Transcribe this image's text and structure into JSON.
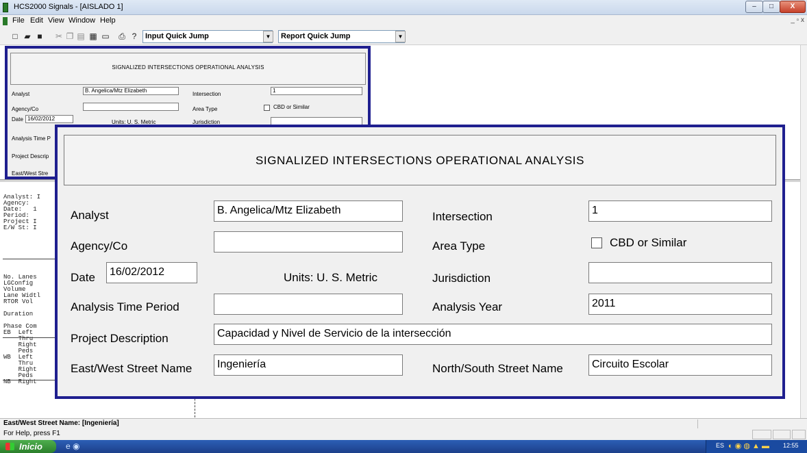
{
  "window": {
    "title": "HCS2000 Signals - [AISLADO 1]",
    "minimize": "–",
    "maximize": "□",
    "close": "X",
    "mdi_controls": "_ ▫ x"
  },
  "menu": [
    "File",
    "Edit",
    "View",
    "Window",
    "Help"
  ],
  "toolbar": {
    "input_quick_jump": "Input Quick Jump",
    "report_quick_jump": "Report Quick Jump",
    "dropdown_arrow": "▼"
  },
  "small_dialog": {
    "title": "SIGNALIZED INTERSECTIONS OPERATIONAL ANALYSIS",
    "analyst_label": "Analyst",
    "analyst_value": "B. Angelica/Mtz Elizabeth",
    "intersection_label": "Intersection",
    "intersection_value": "1",
    "agency_label": "Agency/Co",
    "area_type_label": "Area Type",
    "cbd_label": "CBD or Similar",
    "date_label": "Date",
    "date_value": "16/02/2012",
    "units_label": "Units: U. S. Metric",
    "jurisdiction_label": "Jurisdiction",
    "analysis_time_label": "Analysis Time P",
    "project_label": "Project Descrip",
    "ew_label": "East/West Stre"
  },
  "big_dialog": {
    "title": "SIGNALIZED INTERSECTIONS OPERATIONAL ANALYSIS",
    "analyst_label": "Analyst",
    "analyst_value": "B. Angelica/Mtz Elizabeth",
    "intersection_label": "Intersection",
    "intersection_value": "1",
    "agency_label": "Agency/Co",
    "agency_value": "",
    "area_type_label": "Area Type",
    "cbd_label": "CBD or Similar",
    "cbd_checked": false,
    "date_label": "Date",
    "date_value": "16/02/2012",
    "units_label": "Units: U. S. Metric",
    "jurisdiction_label": "Jurisdiction",
    "jurisdiction_value": "",
    "analysis_time_label": "Analysis Time Period",
    "analysis_time_value": "",
    "analysis_year_label": "Analysis Year",
    "analysis_year_value": "2011",
    "project_label": "Project Description",
    "project_value": "Capacidad y Nivel de Servicio de la intersección",
    "ew_label": "East/West Street Name",
    "ew_value": "Ingeniería",
    "ns_label": "North/South Street Name",
    "ns_value": "Circuito Escolar"
  },
  "report": {
    "lines": [
      "Analyst: I",
      "Agency:",
      "Date:   1",
      "Period:",
      "Project I",
      "E/W St: I",
      "",
      "",
      "",
      "",
      "",
      "",
      "",
      "No. Lanes",
      "LGConfig",
      "Volume",
      "Lane Widtl",
      "RTOR Vol",
      "",
      "Duration",
      "",
      "Phase Com",
      "EB  Left",
      "    Thru",
      "    Right",
      "    Peds",
      "WB  Left                              |  SB  Left",
      "    Thru                              |      Thru",
      "    Right         P                   |      Right",
      "    Peds                              |      Peds",
      "NB  Right                             |  EB  Right"
    ]
  },
  "status": {
    "line1": "East/West Street Name: [Ingeniería]",
    "line2": "For Help, press F1"
  },
  "taskbar": {
    "start": "Inicio",
    "quick_launch": "e ◉",
    "lang": "ES",
    "tray_icons": "◐ ◉ ◍ ▲ ▬",
    "clock": "12:55"
  }
}
